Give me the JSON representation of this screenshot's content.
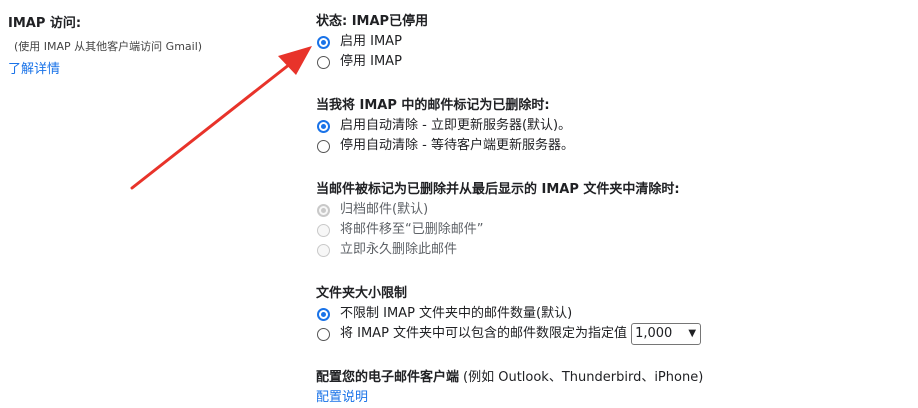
{
  "left": {
    "title": "IMAP 访问:",
    "subtitle": "(使用 IMAP 从其他客户端访问 Gmail)",
    "learn_more": "了解详情"
  },
  "status": {
    "title": "状态: IMAP已停用",
    "options": [
      "启用 IMAP",
      "停用 IMAP"
    ],
    "selected": 0
  },
  "delete_mark": {
    "title": "当我将 IMAP 中的邮件标记为已删除时:",
    "options": [
      "启用自动清除 - 立即更新服务器(默认)。",
      "停用自动清除 - 等待客户端更新服务器。"
    ],
    "selected": 0
  },
  "expunge": {
    "title": "当邮件被标记为已删除并从最后显示的 IMAP 文件夹中清除时:",
    "options": [
      "归档邮件(默认)",
      "将邮件移至“已删除邮件”",
      "立即永久删除此邮件"
    ],
    "selected": 0,
    "disabled": true
  },
  "folder_size": {
    "title": "文件夹大小限制",
    "options": [
      "不限制 IMAP 文件夹中的邮件数量(默认)",
      "将 IMAP 文件夹中可以包含的邮件数限定为指定值"
    ],
    "selected": 0,
    "limit_value": "1,000"
  },
  "configure": {
    "title": "配置您的电子邮件客户端",
    "hint": "(例如 Outlook、Thunderbird、iPhone)",
    "link": "配置说明"
  },
  "colors": {
    "accent": "#1a73e8",
    "arrow": "#e8332a",
    "link": "#1a73e8"
  }
}
